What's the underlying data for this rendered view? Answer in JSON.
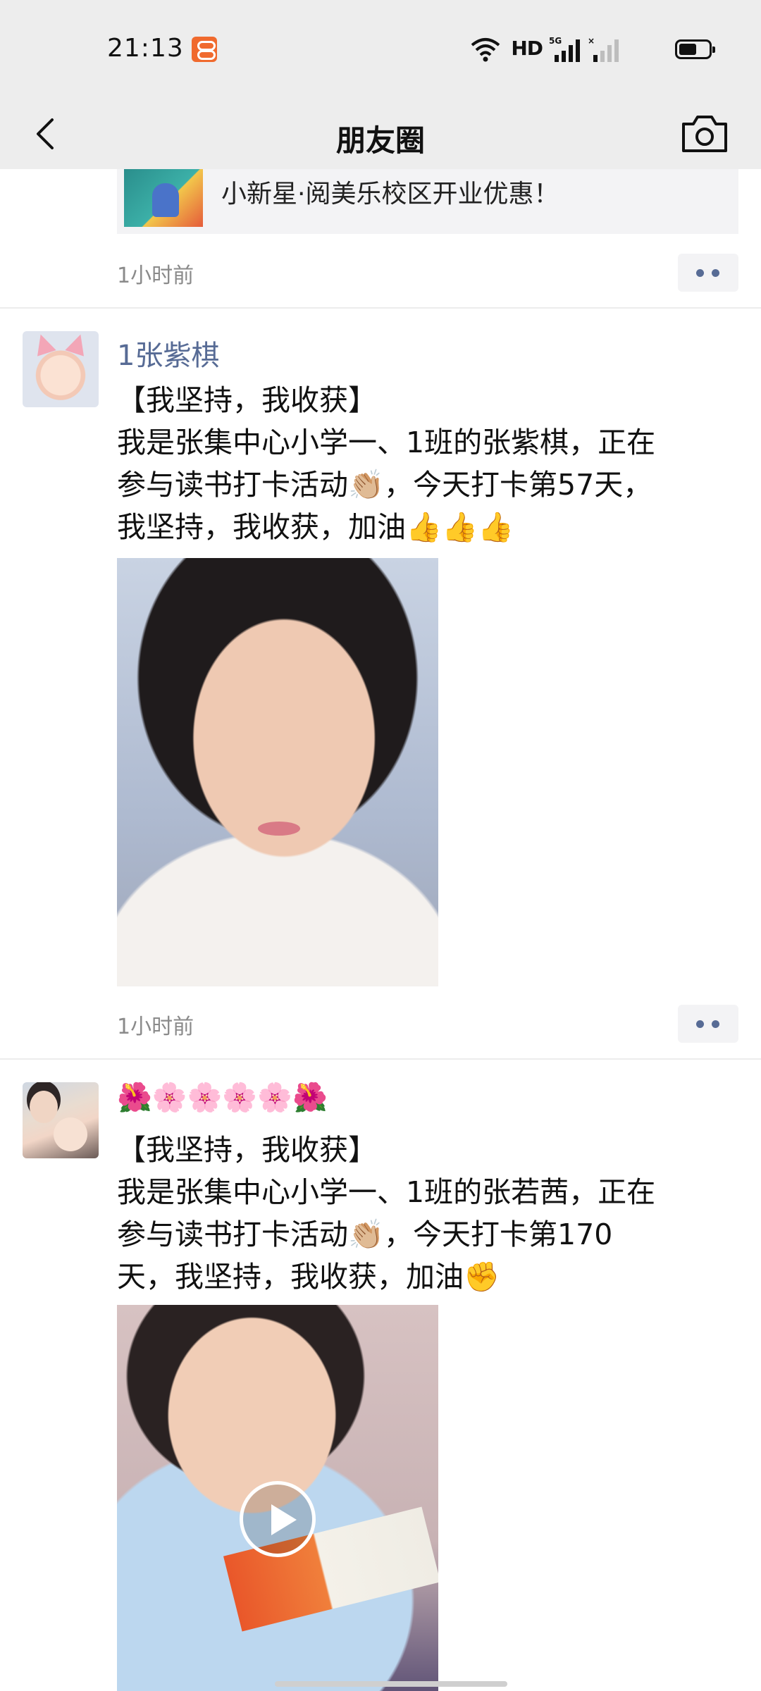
{
  "status_bar": {
    "time": "21:13",
    "network_label": "HD",
    "signal_label": "5G"
  },
  "nav": {
    "title": "朋友圈"
  },
  "feed": {
    "top_post": {
      "share_title": "小新星·阅美乐校区开业优惠！",
      "time": "1小时前"
    },
    "posts": [
      {
        "nickname": "1张紫棋",
        "lines": [
          "【我坚持，我收获】",
          "我是张集中心小学一、1班的张紫棋，正在",
          "参与读书打卡活动👏🏼，今天打卡第57天，",
          "我坚持，我收获，加油👍👍👍"
        ],
        "media_type": "photo",
        "time": "1小时前"
      },
      {
        "nickname": "🌺🌸🌸🌸🌸🌺",
        "lines": [
          "【我坚持，我收获】",
          "我是张集中心小学一、1班的张若茜，正在",
          "参与读书打卡活动👏🏼，今天打卡第170",
          "天，我坚持，我收获，加油✊"
        ],
        "media_type": "video"
      }
    ]
  },
  "colors": {
    "bar_background": "#ededed",
    "nickname": "#576b95",
    "time_text": "#8a8a8a",
    "card_background": "#f3f3f5"
  }
}
